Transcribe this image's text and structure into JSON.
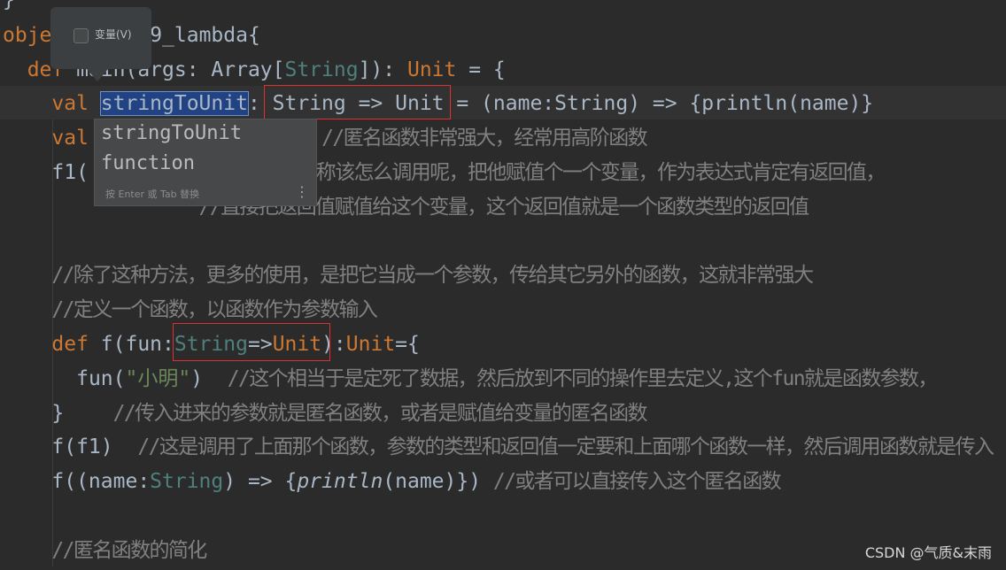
{
  "editor": {
    "colors": {
      "background": "#2b2b2b",
      "keyword": "#cc7832",
      "type": "#4e807d",
      "comment": "#808080",
      "string": "#6a8759",
      "text": "#a9b7c6",
      "selection": "#214283",
      "highlight_box": "#e03030"
    },
    "lines": [
      {
        "row": 0,
        "col": 0,
        "tokens": [
          {
            "t": "}",
            "c": ""
          }
        ]
      },
      {
        "row": 1,
        "col": 0,
        "tokens": [
          {
            "t": "obje",
            "c": "kw"
          }
        ]
      },
      {
        "row": 1,
        "col": 12,
        "tokens": [
          {
            "t": "9_lambda{",
            "c": ""
          }
        ]
      },
      {
        "row": 2,
        "col": 2,
        "tokens": [
          {
            "t": "def ",
            "c": "kw"
          },
          {
            "t": "main",
            "c": "fn"
          },
          {
            "t": "(args: Array[",
            "c": ""
          },
          {
            "t": "String",
            "c": "ty"
          },
          {
            "t": "]): ",
            "c": ""
          },
          {
            "t": "Unit",
            "c": "kw"
          },
          {
            "t": " = {",
            "c": ""
          }
        ]
      },
      {
        "row": 3,
        "col": 4,
        "tokens": [
          {
            "t": "val ",
            "c": "kw"
          },
          {
            "t": "stringToUnit",
            "c": "sel"
          },
          {
            "t": ": String => Unit = (name:String) => {println(name)}",
            "c": ""
          }
        ]
      },
      {
        "row": 4,
        "col": 4,
        "tokens": [
          {
            "t": "val",
            "c": "kw"
          }
        ]
      },
      {
        "row": 4,
        "col": 26,
        "tokens": [
          {
            "t": "//匿名函数非常强大，经常用高阶函数",
            "c": "cm"
          }
        ]
      },
      {
        "row": 5,
        "col": 4,
        "tokens": [
          {
            "t": "f1(",
            "c": ""
          }
        ]
      },
      {
        "row": 5,
        "col": 24,
        "tokens": [
          {
            "t": "名称该怎么调用呢，把他赋值个一个变量，作为表达式肯定有返回值，",
            "c": "cm"
          }
        ]
      },
      {
        "row": 6,
        "col": 16,
        "tokens": [
          {
            "t": "//直接把返回值赋值给这个变量，这个返回值就是一个函数类型的返回值",
            "c": "cm"
          }
        ]
      },
      {
        "row": 8,
        "col": 4,
        "tokens": [
          {
            "t": "//除了这种方法，更多的使用，是把它当成一个参数，传给其它另外的函数，这就非常强大",
            "c": "cm"
          }
        ]
      },
      {
        "row": 9,
        "col": 4,
        "tokens": [
          {
            "t": "//定义一个函数，以函数作为参数输入",
            "c": "cm"
          }
        ]
      },
      {
        "row": 10,
        "col": 4,
        "tokens": [
          {
            "t": "def ",
            "c": "kw"
          },
          {
            "t": "f",
            "c": "fn"
          },
          {
            "t": "(fun:",
            "c": ""
          },
          {
            "t": "String",
            "c": "ty"
          },
          {
            "t": "=>",
            "c": ""
          },
          {
            "t": "Unit",
            "c": "kw"
          },
          {
            "t": "):",
            "c": ""
          },
          {
            "t": "Unit",
            "c": "kw"
          },
          {
            "t": "={",
            "c": ""
          }
        ]
      },
      {
        "row": 11,
        "col": 6,
        "tokens": [
          {
            "t": "fun(",
            "c": ""
          },
          {
            "t": "\"小明\"",
            "c": "st"
          },
          {
            "t": ")  ",
            "c": ""
          },
          {
            "t": "//这个相当于是定死了数据，然后放到不同的操作里去定义,这个fun就是函数参数，",
            "c": "cm"
          }
        ]
      },
      {
        "row": 12,
        "col": 4,
        "tokens": [
          {
            "t": "}    ",
            "c": ""
          },
          {
            "t": "//传入进来的参数就是匿名函数，或者是赋值给变量的匿名函数",
            "c": "cm"
          }
        ]
      },
      {
        "row": 13,
        "col": 4,
        "tokens": [
          {
            "t": "f(f1)  ",
            "c": ""
          },
          {
            "t": "//这是调用了上面那个函数，参数的类型和返回值一定要和上面哪个函数一样，然后调用函数就是传入",
            "c": "cm"
          }
        ]
      },
      {
        "row": 14,
        "col": 4,
        "tokens": [
          {
            "t": "f((name:",
            "c": ""
          },
          {
            "t": "String",
            "c": "ty"
          },
          {
            "t": ") => {",
            "c": ""
          },
          {
            "t": "println",
            "c": "it"
          },
          {
            "t": "(name)}) ",
            "c": ""
          },
          {
            "t": "//或者可以直接传入这个匿名函数",
            "c": "cm"
          }
        ]
      },
      {
        "row": 16,
        "col": 4,
        "tokens": [
          {
            "t": "//匿名函数的简化",
            "c": "cm"
          }
        ]
      }
    ]
  },
  "tooltip": {
    "checkbox_label": "变量(V)",
    "checked": false
  },
  "completion_popup": {
    "items": [
      "stringToUnit",
      "function"
    ],
    "hint": "按 Enter 或 Tab 替换",
    "more_icon": "vertical-ellipsis-icon"
  },
  "watermark": "CSDN @气质&末雨"
}
